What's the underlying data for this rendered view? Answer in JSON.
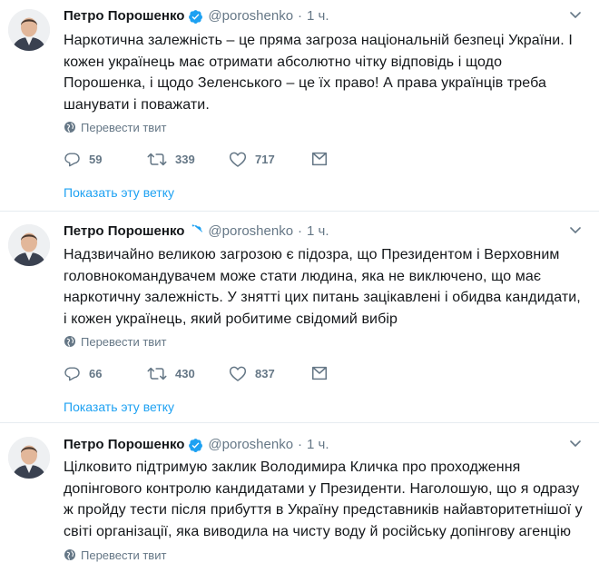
{
  "tweets": [
    {
      "name": "Петро Порошенко",
      "handle": "@poroshenko",
      "separator": "·",
      "time": "1 ч.",
      "text": "Наркотична залежність – це пряма загроза національній безпеці України. І кожен українець має отримати абсолютно чітку відповідь і щодо Порошенка, і щодо Зеленського – це їх право! А права українців треба шанувати і поважати.",
      "translate": "Перевести твит",
      "replies": "59",
      "retweets": "339",
      "likes": "717",
      "thread": "Показать эту ветку"
    },
    {
      "name": "Петро Порошенко",
      "handle": "@poroshenko",
      "separator": "·",
      "time": "1 ч.",
      "text": "Надзвичайно великою загрозою є підозра, що Президентом і Верховним головнокомандувачем може стати людина, яка не виключено, що має наркотичну залежність. У знятті цих питань зацікавлені і обидва кандидати, і кожен українець, який робитиме свідомий вибір",
      "translate": "Перевести твит",
      "replies": "66",
      "retweets": "430",
      "likes": "837",
      "thread": "Показать эту ветку"
    },
    {
      "name": "Петро Порошенко",
      "handle": "@poroshenko",
      "separator": "·",
      "time": "1 ч.",
      "text": "Цілковито підтримую заклик Володимира Кличка про проходження допінгового контролю кандидатами у Президенти. Наголошую, що я одразу ж пройду тести після прибуття в Україну представників найавторитетнішої у світі організації, яка виводила на чисту воду й російську допінгову агенцію",
      "translate": "Перевести твит"
    }
  ],
  "colors": {
    "link": "#1da1f2",
    "muted": "#657786",
    "text": "#14171a",
    "border": "#e6ecf0"
  },
  "icons": [
    "verified-badge-icon",
    "chevron-down-icon",
    "globe-icon",
    "reply-icon",
    "retweet-icon",
    "like-icon",
    "dm-icon"
  ]
}
